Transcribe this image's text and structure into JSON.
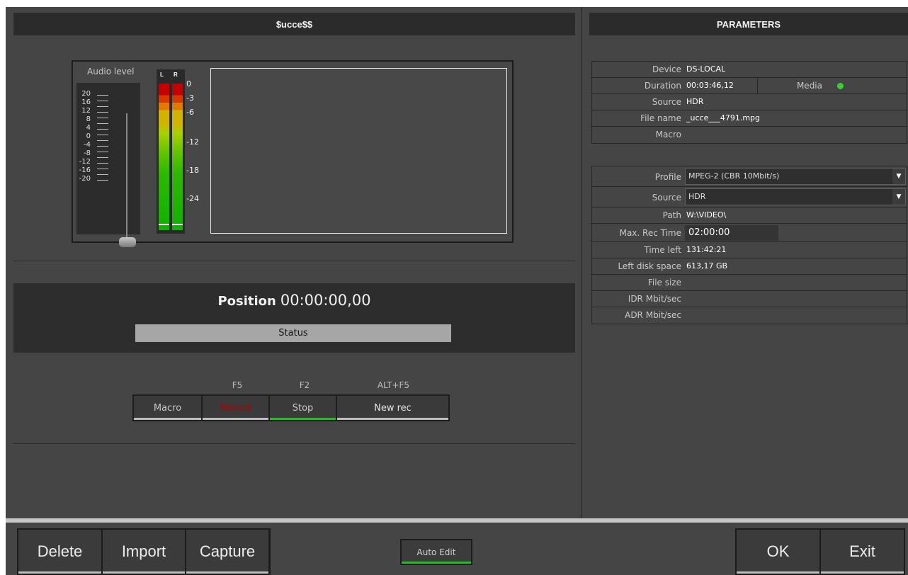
{
  "left_header": {
    "title": "$ucce$$"
  },
  "right_header": {
    "title": "PARAMETERS"
  },
  "audio": {
    "label": "Audio level",
    "scale": [
      "20",
      "16",
      "12",
      "8",
      "4",
      "0",
      "-4",
      "-8",
      "-12",
      "-16",
      "-20"
    ],
    "meter_channels": [
      "L",
      "R"
    ],
    "meter_db": [
      "0",
      "-3",
      "-6",
      "-12",
      "-18",
      "-24"
    ],
    "fader_level_db": -20
  },
  "position": {
    "label": "Position",
    "value": "00:00:00,00",
    "status": "Status"
  },
  "transport": {
    "shortcuts": {
      "record": "F5",
      "stop": "F2",
      "new_rec": "ALT+F5"
    },
    "macro": "Macro",
    "record": "Record",
    "stop": "Stop",
    "new_rec": "New rec"
  },
  "parameters": {
    "device_label": "Device",
    "device": "DS-LOCAL",
    "duration_label": "Duration",
    "duration": "00:03:46,12",
    "media_label": "Media",
    "media_color": "#3cd12f",
    "source_label": "Source",
    "source": "HDR",
    "filename_label": "File name",
    "filename": "_ucce___4791.mpg",
    "macro_label": "Macro",
    "macro": ""
  },
  "settings": {
    "profile_label": "Profile",
    "profile": "MPEG-2 (CBR 10Mbit/s)",
    "source_label": "Source",
    "source": "HDR",
    "path_label": "Path",
    "path": "W:\\VIDEO\\",
    "max_rec_label": "Max. Rec Time",
    "max_rec": "02:00:00",
    "time_left_label": "Time left",
    "time_left": "131:42:21",
    "disk_label": "Left disk space",
    "disk": "613,17 GB",
    "file_size_label": "File size",
    "file_size": "",
    "idr_label": "IDR Mbit/sec",
    "idr": "",
    "adr_label": "ADR Mbit/sec",
    "adr": ""
  },
  "bottom": {
    "delete": "Delete",
    "import": "Import",
    "capture": "Capture",
    "auto_edit": "Auto Edit",
    "ok": "OK",
    "exit": "Exit"
  }
}
